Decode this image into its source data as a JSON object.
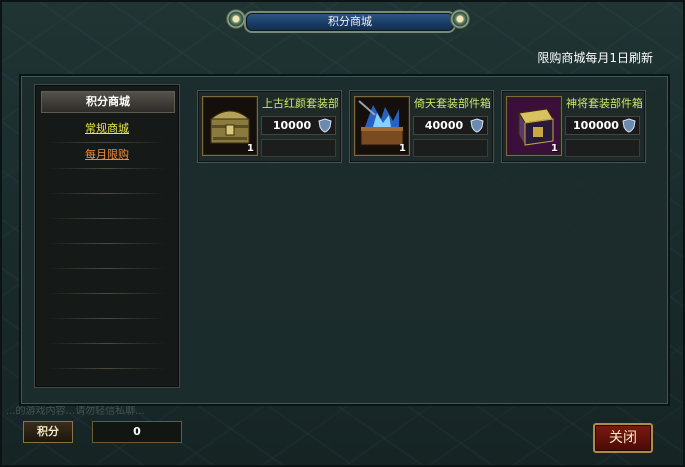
{
  "window": {
    "title": "积分商城"
  },
  "notice": "限购商城每月1日刷新",
  "nav": {
    "header": "积分商城",
    "items": [
      {
        "label": "常规商城",
        "color": "#e6e64a"
      },
      {
        "label": "每月限购",
        "color": "#f08a3a"
      }
    ]
  },
  "items": [
    {
      "name": "上古红颜套装部件",
      "price": "10000",
      "qty": "1",
      "icon": "golden-chest-icon"
    },
    {
      "name": "倚天套装部件箱",
      "price": "40000",
      "qty": "1",
      "icon": "blue-flame-chest-icon"
    },
    {
      "name": "神将套装部件箱",
      "price": "100000",
      "qty": "1",
      "icon": "purple-chest-icon"
    }
  ],
  "points": {
    "label": "积分",
    "value": "0"
  },
  "close_label": "关闭",
  "background_chat": "...的游戏内容...请勿轻信私聊..."
}
